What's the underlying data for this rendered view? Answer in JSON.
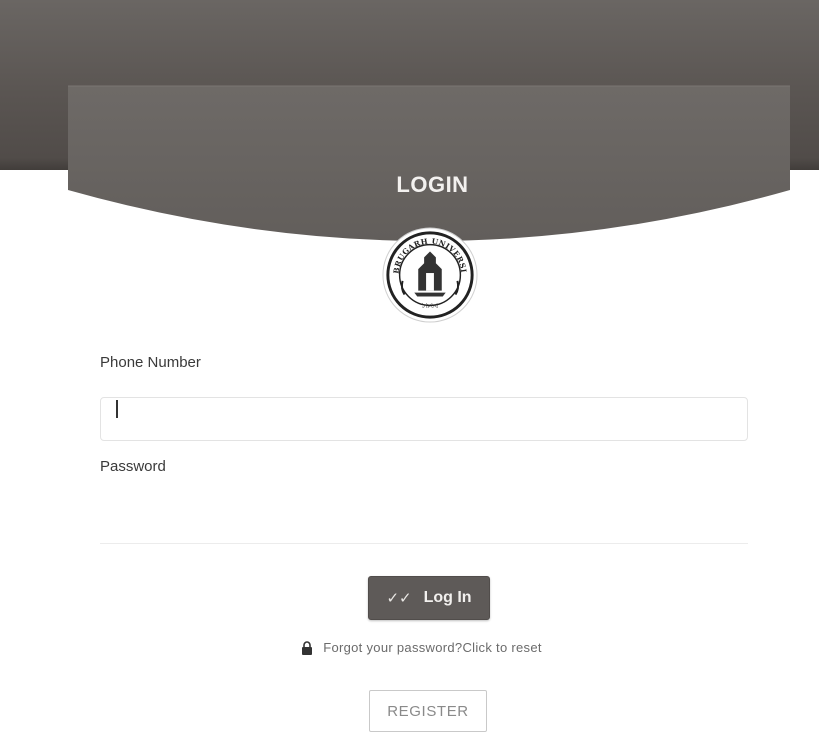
{
  "header": {
    "title": "LOGIN",
    "logo_text_top": "DIBRUGARH UNIVERSITY",
    "logo_text_bottom": "১৯৬৫"
  },
  "form": {
    "phone_label": "Phone Number",
    "phone_value": "",
    "password_label": "Password",
    "password_value": ""
  },
  "actions": {
    "login_label": "Log In",
    "login_icon": "double-check-icon",
    "forgot_label": "Forgot your password?Click to reset",
    "forgot_icon": "lock-icon",
    "register_label": "REGISTER"
  },
  "colors": {
    "header": "#5e5a58",
    "button": "#5e5a58"
  }
}
